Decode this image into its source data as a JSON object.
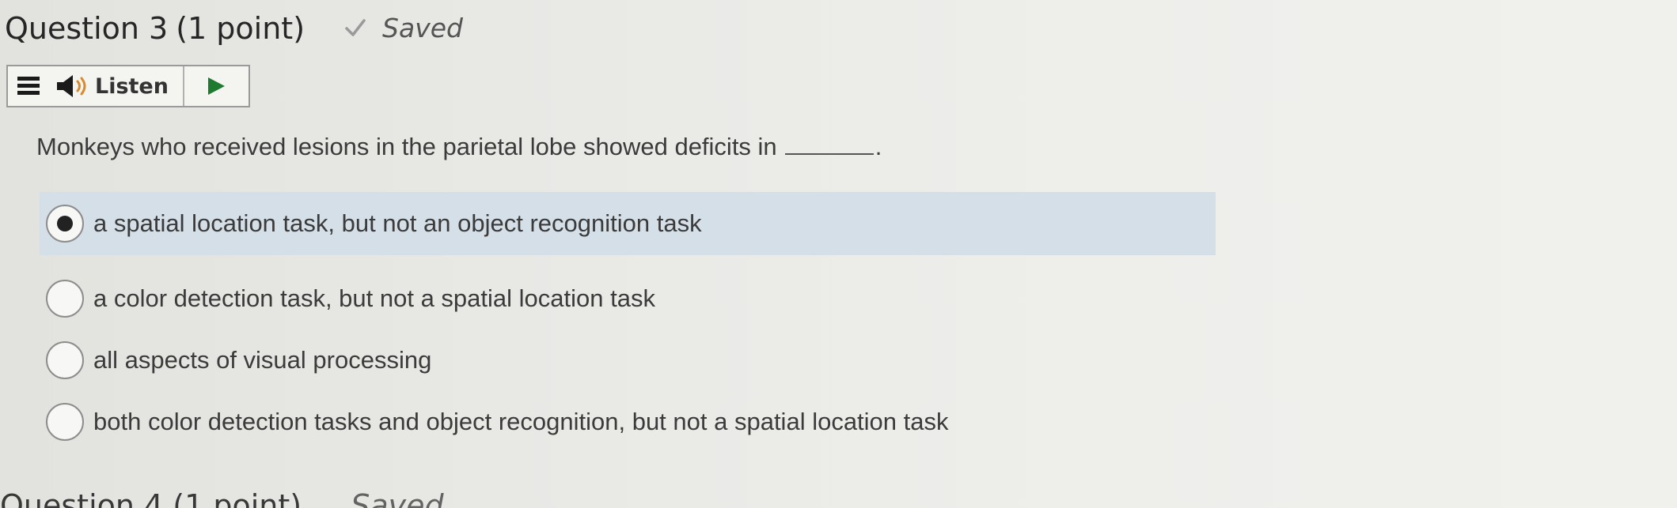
{
  "question": {
    "title": "Question 3",
    "points": "(1 point)",
    "status": "Saved",
    "text": "Monkeys who received lesions in the parietal lobe showed deficits in",
    "blank_suffix": "."
  },
  "listen_toolbar": {
    "label": "Listen",
    "icons": [
      "menu-icon",
      "speaker-icon",
      "play-icon"
    ]
  },
  "options": [
    {
      "label": "a spatial location task, but not an object recognition task",
      "selected": true
    },
    {
      "label": "a color detection task, but not a spatial location task",
      "selected": false
    },
    {
      "label": "all aspects of visual processing",
      "selected": false
    },
    {
      "label": "both color detection tasks and object recognition, but not a spatial location task",
      "selected": false
    }
  ],
  "next_question": {
    "title": "Question 4 (1 point)",
    "status": "Saved"
  },
  "colors": {
    "selected_bg": "#d5dfe8",
    "play_accent": "#1e7a2e",
    "speaker_accent": "#d98a2b"
  }
}
